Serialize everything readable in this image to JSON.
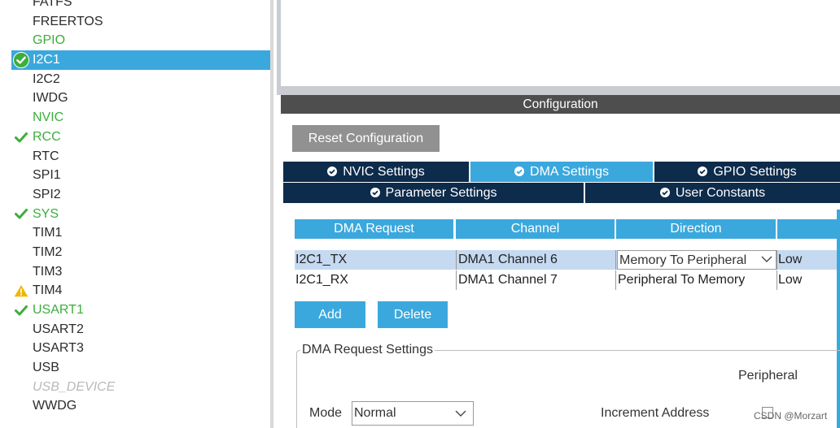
{
  "sidebar": {
    "items": [
      {
        "label": "FATFS",
        "status": "none"
      },
      {
        "label": "FREERTOS",
        "status": "none"
      },
      {
        "label": "GPIO",
        "status": "none",
        "color": "green"
      },
      {
        "label": "I2C1",
        "status": "check",
        "selected": true
      },
      {
        "label": "I2C2",
        "status": "none"
      },
      {
        "label": "IWDG",
        "status": "none"
      },
      {
        "label": "NVIC",
        "status": "none",
        "color": "green"
      },
      {
        "label": "RCC",
        "status": "check",
        "color": "green"
      },
      {
        "label": "RTC",
        "status": "none"
      },
      {
        "label": "SPI1",
        "status": "none"
      },
      {
        "label": "SPI2",
        "status": "none"
      },
      {
        "label": "SYS",
        "status": "check",
        "color": "green"
      },
      {
        "label": "TIM1",
        "status": "none"
      },
      {
        "label": "TIM2",
        "status": "none"
      },
      {
        "label": "TIM3",
        "status": "none"
      },
      {
        "label": "TIM4",
        "status": "warning"
      },
      {
        "label": "USART1",
        "status": "check",
        "color": "green"
      },
      {
        "label": "USART2",
        "status": "none"
      },
      {
        "label": "USART3",
        "status": "none"
      },
      {
        "label": "USB",
        "status": "none"
      },
      {
        "label": "USB_DEVICE",
        "status": "none",
        "disabled": true
      },
      {
        "label": "WWDG",
        "status": "none"
      }
    ]
  },
  "config": {
    "header": "Configuration",
    "reset_label": "Reset Configuration",
    "tabs": {
      "nvic": "NVIC Settings",
      "dma": "DMA Settings",
      "gpio": "GPIO Settings",
      "param": "Parameter Settings",
      "user": "User Constants"
    },
    "active_tab": "dma"
  },
  "dma_table": {
    "headers": {
      "request": "DMA Request",
      "channel": "Channel",
      "direction": "Direction",
      "priority": ""
    },
    "rows": [
      {
        "request": "I2C1_TX",
        "channel": "DMA1 Channel 6",
        "direction": "Memory To Peripheral",
        "priority": "Low",
        "selected": true
      },
      {
        "request": "I2C1_RX",
        "channel": "DMA1 Channel 7",
        "direction": "Peripheral To Memory",
        "priority": "Low"
      }
    ],
    "add_label": "Add",
    "delete_label": "Delete"
  },
  "request_settings": {
    "legend": "DMA Request Settings",
    "peripheral_header": "Peripheral",
    "mode_label": "Mode",
    "mode_value": "Normal",
    "increment_label": "Increment Address",
    "increment_checked": false
  },
  "watermark": "CSDN @Morzart",
  "colors": {
    "accent_blue": "#3ba8dd",
    "tab_navy": "#0d2b4b",
    "green_text": "#3cae3c",
    "warning_yellow": "#f2b600",
    "header_gray": "#4e4e4e"
  },
  "icons": {
    "check": "check-circle-icon",
    "warning": "warning-triangle-icon",
    "tab": "check-circle-icon"
  }
}
